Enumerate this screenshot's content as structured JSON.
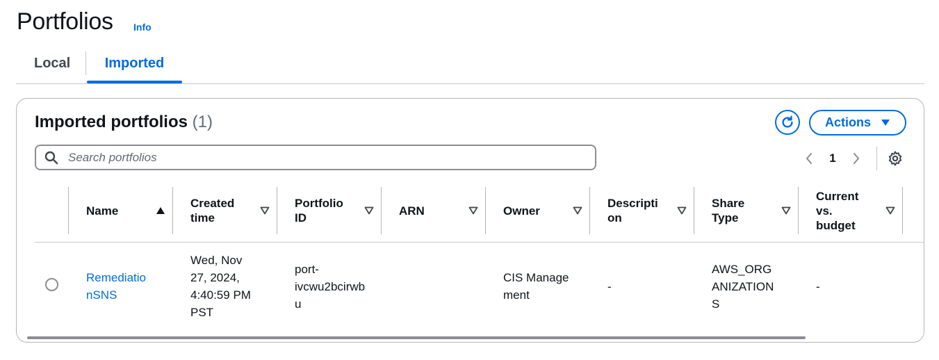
{
  "page": {
    "title": "Portfolios",
    "info_label": "Info"
  },
  "tabs": [
    {
      "label": "Local",
      "selected": false
    },
    {
      "label": "Imported",
      "selected": true
    }
  ],
  "panel": {
    "title": "Imported portfolios",
    "count": "(1)",
    "actions_label": "Actions",
    "search_placeholder": "Search portfolios",
    "search_value": "",
    "page_number": "1"
  },
  "table": {
    "columns": [
      {
        "label": "Name",
        "sort": "ascending"
      },
      {
        "label": "Created time",
        "sort": "none"
      },
      {
        "label": "Portfolio ID",
        "sort": "none"
      },
      {
        "label": "ARN",
        "sort": "none"
      },
      {
        "label": "Owner",
        "sort": "none"
      },
      {
        "label": "Description",
        "sort": "none"
      },
      {
        "label": "Share Type",
        "sort": "none"
      },
      {
        "label": "Current vs. budget",
        "sort": "none"
      }
    ],
    "rows": [
      {
        "selected": false,
        "name": "RemediationSNS",
        "created_time": "Wed, Nov 27, 2024, 4:40:59 PM PST",
        "portfolio_id": "port-ivcwu2bcirwbu",
        "arn": "",
        "owner": "CIS Management",
        "description": "-",
        "share_type": "AWS_ORGANIZATIONS",
        "current_vs_budget": "-"
      }
    ]
  },
  "icons": {
    "refresh": "refresh-icon",
    "search": "search-icon",
    "settings": "gear-icon",
    "prev": "chevron-left-icon",
    "next": "chevron-right-icon",
    "dropdown": "caret-down-icon"
  },
  "colors": {
    "accent": "#006ce0",
    "text": "#0f141a",
    "border": "#b4b4bb"
  }
}
